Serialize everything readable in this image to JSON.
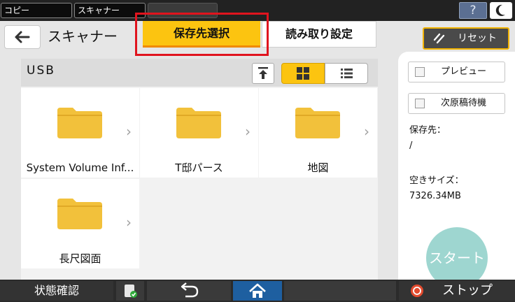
{
  "top_tabs": [
    "コピー",
    "スキャナー",
    ""
  ],
  "help_label": "?",
  "header": {
    "title": "スキャナー",
    "tabs": [
      "保存先選択",
      "読み取り設定"
    ],
    "reset_label": "リセット"
  },
  "browser": {
    "path": "USB",
    "items": [
      {
        "name": "System Volume Inf..."
      },
      {
        "name": "T邸パース"
      },
      {
        "name": "地図"
      },
      {
        "name": "長尺図面"
      }
    ]
  },
  "side": {
    "preview_label": "プレビュー",
    "next_original_label": "次原稿待機",
    "destination_label": "保存先：",
    "destination_value": "/",
    "free_space_label": "空きサイズ：",
    "free_space_value": "7326.34MB",
    "start_label": "スタート"
  },
  "bottom": {
    "status_label": "状態確認",
    "stop_label": "ストップ"
  },
  "colors": {
    "accent_yellow": "#fcc410",
    "highlight_red": "#e0141e",
    "start_teal": "#9ed6d0",
    "home_blue": "#1e5fa0",
    "folder_yellow": "#f2c13b"
  },
  "icons": [
    "back-arrow-icon",
    "folder-icon",
    "chevron-right-icon",
    "upload-icon",
    "grid-view-icon",
    "list-view-icon",
    "reset-icon",
    "moon-icon",
    "help-icon",
    "job-status-icon",
    "undo-icon",
    "home-icon",
    "stop-icon"
  ]
}
